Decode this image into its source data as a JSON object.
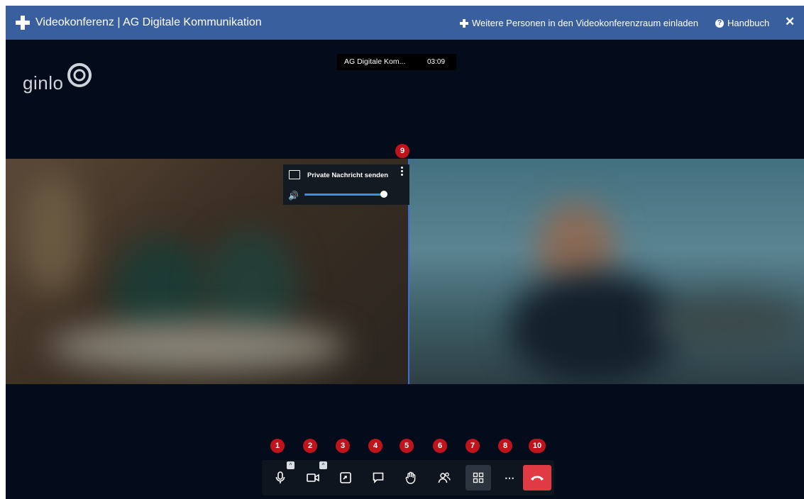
{
  "header": {
    "title": "Videokonferenz | AG Digitale Kommunikation",
    "invite_label": "Weitere Personen in den Videokonferenzraum einladen",
    "manual_label": "Handbuch",
    "close_icon": "close-icon",
    "accent_color": "#3a5f9f"
  },
  "logo": {
    "text": "ginlo"
  },
  "status_bar": {
    "room_name": "AG Digitale Kom...",
    "timer": "03:09"
  },
  "participant_menu": {
    "private_message_label": "Private Nachricht senden",
    "volume_percent": 100
  },
  "callout_badges": {
    "b1": "1",
    "b2": "2",
    "b3": "3",
    "b4": "4",
    "b5": "5",
    "b6": "6",
    "b7": "7",
    "b8": "8",
    "b9": "9",
    "b10": "10"
  },
  "toolbar": {
    "items": [
      {
        "name": "microphone",
        "icon": "microphone-icon"
      },
      {
        "name": "camera",
        "icon": "camera-icon"
      },
      {
        "name": "screen-share",
        "icon": "screen-share-icon"
      },
      {
        "name": "chat",
        "icon": "chat-icon"
      },
      {
        "name": "raise-hand",
        "icon": "hand-icon"
      },
      {
        "name": "participants",
        "icon": "participants-icon"
      },
      {
        "name": "tile-view",
        "icon": "grid-icon"
      },
      {
        "name": "more",
        "icon": "more-icon"
      },
      {
        "name": "hangup",
        "icon": "phone-hangup-icon"
      }
    ],
    "more_label": "⋯",
    "hangup_color": "#e03a45"
  }
}
